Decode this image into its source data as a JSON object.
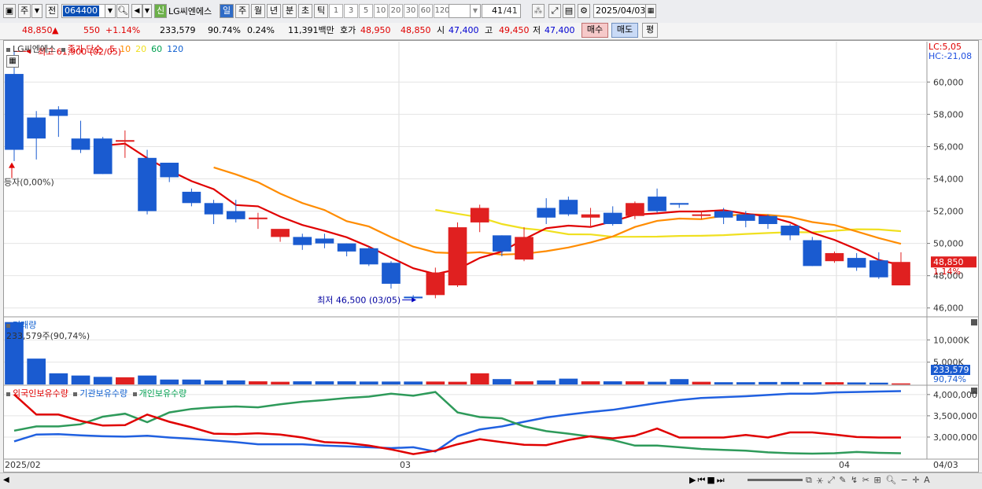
{
  "toolbar": {
    "period_btn": "주",
    "prev_btn": "전",
    "code": "064400",
    "name": "LG씨엔에스",
    "new_badge": "신",
    "tf": [
      "일",
      "주",
      "월",
      "년",
      "분",
      "초",
      "틱"
    ],
    "nums": [
      "1",
      "3",
      "5",
      "10",
      "20",
      "30",
      "60",
      "120"
    ],
    "count": "41",
    "count_total": "/41",
    "date": "2025/04/03"
  },
  "quote": {
    "price": "48,850",
    "arrow": "▲",
    "change": "550",
    "change_pct": "+1.14%",
    "volume": "233,579",
    "vol_ratio": "90.74%",
    "turnover": "0.24%",
    "amount": "11,391백만",
    "hoga_label": "호가",
    "ask": "48,950",
    "bid": "48,850",
    "open_label": "시",
    "open": "47,400",
    "high_label": "고",
    "high": "49,450",
    "low_label": "저",
    "low": "47,400",
    "buy_btn": "매수",
    "sell_btn": "매도",
    "eval_btn": "평"
  },
  "price_panel": {
    "name": "LG씨엔에스",
    "ma_title": "종가 단순",
    "ma_periods": [
      "5",
      "10",
      "20",
      "60",
      "120"
    ],
    "max_label": "최고 61,900 (02/05)",
    "min_label": "최저 46,500 (03/05)",
    "left_label": "등자(0,00%)",
    "lc": "LC:5,05",
    "hc": "HC:-21,08",
    "y_ticks": [
      "60,000",
      "58,000",
      "56,000",
      "54,000",
      "52,000",
      "50,000",
      "48,000",
      "46,000"
    ],
    "last_price": "48,850",
    "last_pct": "1.14%"
  },
  "volume_panel": {
    "title": "거래량",
    "value": "233,579주(90,74%)",
    "y_ticks": [
      "10,000K",
      "5,000K"
    ],
    "last_value": "233,579",
    "last_pct": "90,74%"
  },
  "holding_panel": {
    "foreign": "외국인보유수량",
    "institution": "기관보유수량",
    "individual": "개인보유수량",
    "y_ticks": [
      "4,000,000",
      "3,500,000",
      "3,000,000"
    ]
  },
  "x_axis": {
    "start": "2025/02",
    "mid": "03",
    "end": "04",
    "right": "04/03"
  },
  "chart_data": {
    "type": "candlestick",
    "dates": [
      "02/05",
      "02/06",
      "02/07",
      "02/10",
      "02/11",
      "02/12",
      "02/13",
      "02/14",
      "02/17",
      "02/18",
      "02/19",
      "02/20",
      "02/21",
      "02/24",
      "02/25",
      "02/26",
      "02/27",
      "02/28",
      "03/04",
      "03/05",
      "03/06",
      "03/07",
      "03/10",
      "03/11",
      "03/12",
      "03/13",
      "03/14",
      "03/17",
      "03/18",
      "03/19",
      "03/20",
      "03/21",
      "03/24",
      "03/25",
      "03/26",
      "03/27",
      "03/28",
      "03/31",
      "04/01",
      "04/02",
      "04/03"
    ],
    "open": [
      60500,
      57800,
      58300,
      56500,
      56500,
      56300,
      55300,
      55000,
      53200,
      52500,
      52000,
      51500,
      50400,
      50400,
      50300,
      50000,
      49700,
      48800,
      46700,
      46800,
      47400,
      51300,
      50500,
      49000,
      52200,
      52700,
      51600,
      51900,
      51700,
      52900,
      52500,
      51800,
      52000,
      51800,
      51700,
      51100,
      50200,
      48900,
      49100,
      48950,
      47400
    ],
    "close": [
      55800,
      56500,
      57900,
      55800,
      54300,
      56400,
      52000,
      54100,
      52500,
      51800,
      51500,
      51600,
      50900,
      49900,
      50000,
      49500,
      48700,
      47500,
      46600,
      48200,
      51000,
      52200,
      49500,
      50400,
      51600,
      51800,
      51800,
      51200,
      52500,
      52000,
      52400,
      51800,
      51600,
      51400,
      51200,
      50500,
      48600,
      49400,
      48500,
      47900,
      48850
    ],
    "high": [
      61900,
      58200,
      58500,
      57600,
      56600,
      57000,
      55800,
      55000,
      53400,
      52700,
      52700,
      51900,
      50800,
      50600,
      50600,
      50000,
      49800,
      48900,
      46800,
      48500,
      51300,
      52400,
      50500,
      51000,
      52800,
      52900,
      52200,
      52300,
      52600,
      53400,
      52500,
      52000,
      52200,
      52000,
      51800,
      51200,
      50400,
      49500,
      49400,
      49450,
      49450
    ],
    "low": [
      55100,
      55200,
      56600,
      55600,
      54300,
      55300,
      51800,
      53800,
      52300,
      51200,
      51300,
      50900,
      50100,
      49600,
      49700,
      49200,
      48600,
      47200,
      46500,
      46600,
      47300,
      50700,
      49200,
      48900,
      51200,
      51700,
      51000,
      51100,
      51500,
      51900,
      52200,
      51500,
      51200,
      51000,
      50900,
      50200,
      48600,
      48800,
      48300,
      47800,
      47400
    ],
    "volume_k": [
      14000,
      5800,
      2500,
      2000,
      1700,
      1600,
      2000,
      1100,
      1100,
      900,
      900,
      700,
      600,
      700,
      700,
      700,
      650,
      650,
      650,
      650,
      600,
      2500,
      1200,
      700,
      900,
      1300,
      700,
      700,
      700,
      600,
      1200,
      600,
      500,
      500,
      550,
      550,
      500,
      500,
      450,
      400,
      233.579
    ],
    "ma_legend": [
      {
        "name": "5",
        "color": "#e00000"
      },
      {
        "name": "10",
        "color": "#ff8c00"
      },
      {
        "name": "20",
        "color": "#f0e020"
      },
      {
        "name": "60",
        "color": "#00a050"
      },
      {
        "name": "120",
        "color": "#1060d0"
      }
    ],
    "ylim": [
      45500,
      62500
    ]
  }
}
